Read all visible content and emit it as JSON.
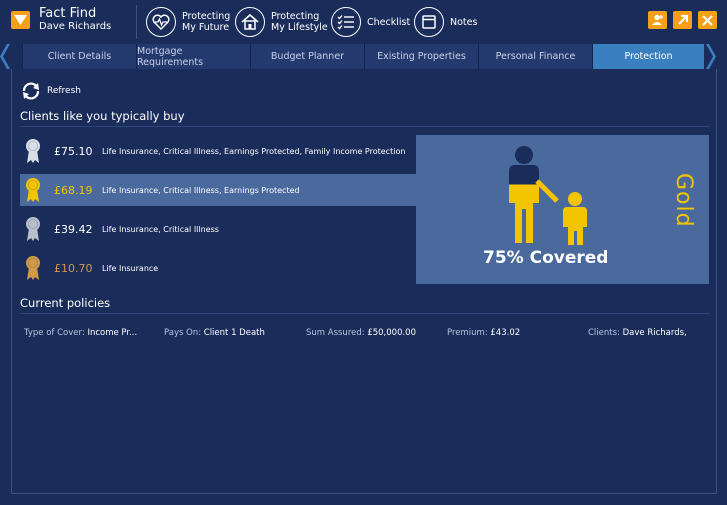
{
  "app": {
    "title": "Fact Find",
    "user": "Dave Richards"
  },
  "header_nav": [
    {
      "label_line1": "Protecting",
      "label_line2": "My Future",
      "icon": "heart-pulse-icon"
    },
    {
      "label_line1": "Protecting",
      "label_line2": "My Lifestyle",
      "icon": "home-icon"
    },
    {
      "label_line1": "Checklist",
      "label_line2": "",
      "icon": "checklist-icon"
    },
    {
      "label_line1": "Notes",
      "label_line2": "",
      "icon": "notes-icon"
    }
  ],
  "tabs": [
    "Client Details",
    "Mortgage Requirements",
    "Budget Planner",
    "Existing Properties",
    "Personal Finance",
    "Protection"
  ],
  "active_tab": "Protection",
  "refresh_label": "Refresh",
  "recommend_title": "Clients like you typically buy",
  "recommendations": [
    {
      "price": "£75.10",
      "desc": "Life Insurance, Critical Illness, Earnings Protected, Family Income Protection",
      "medal": "platinum",
      "medal_color": "#d9dde6"
    },
    {
      "price": "£68.19",
      "desc": "Life Insurance, Critical Illness, Earnings Protected",
      "medal": "gold",
      "medal_color": "#f3c500",
      "selected": true
    },
    {
      "price": "£39.42",
      "desc": "Life Insurance, Critical Illness",
      "medal": "silver",
      "medal_color": "#b9bfcb"
    },
    {
      "price": "£10.70",
      "desc": "Life Insurance",
      "medal": "bronze",
      "medal_color": "#d19a4a"
    }
  ],
  "cover": {
    "text": "75% Covered",
    "level": "Gold",
    "fill_fraction": 0.75
  },
  "policies_title": "Current policies",
  "policy": {
    "type_key": "Type of Cover:",
    "type_val": "Income Pr...",
    "pays_key": "Pays On:",
    "pays_val": "Client 1 Death",
    "sum_key": "Sum Assured:",
    "sum_val": "£50,000.00",
    "premium_key": "Premium:",
    "premium_val": "£43.02",
    "clients_key": "Clients:",
    "clients_val": "Dave Richards,"
  },
  "colors": {
    "accent": "#f6a01a",
    "gold": "#f3c500",
    "background": "#1a2c5a",
    "active_tab": "#3a7fc0",
    "highlight": "#4a6a9e"
  }
}
